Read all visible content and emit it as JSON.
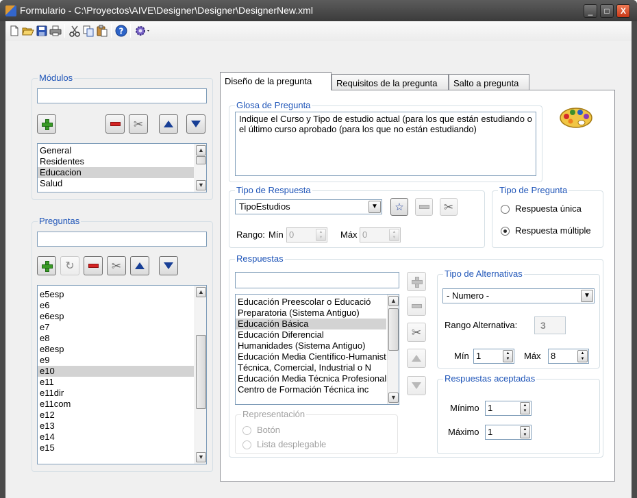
{
  "window": {
    "title": "Formulario - C:\\Proyectos\\AIVE\\Designer\\Designer\\DesignerNew.xml",
    "minimize_glyph": "_",
    "maximize_glyph": "□",
    "close_glyph": "X"
  },
  "toolbar": {
    "icons": [
      "new-icon",
      "open-icon",
      "save-icon",
      "print-icon",
      "cut-icon",
      "copy-icon",
      "paste-icon",
      "help-icon",
      "settings-icon"
    ]
  },
  "modulos": {
    "label": "Módulos",
    "search_value": "",
    "items": [
      "General",
      "Residentes",
      "Educacion",
      "Salud"
    ],
    "selected": "Educacion"
  },
  "preguntas": {
    "label": "Preguntas",
    "search_value": "",
    "items": [
      "e5esp",
      "e6",
      "e6esp",
      "e7",
      "e8",
      "e8esp",
      "e9",
      "e10",
      "e11",
      "e11dir",
      "e11com",
      "e12",
      "e13",
      "e14",
      "e15"
    ],
    "selected": "e10"
  },
  "tabs": [
    "Diseño de la pregunta",
    "Requisitos de la pregunta",
    "Salto a pregunta"
  ],
  "glosa": {
    "label": "Glosa de Pregunta",
    "text": "Indique el Curso y Tipo de estudio actual (para los que están estudiando o el último curso aprobado (para los que no están estudiando)"
  },
  "tipo_respuesta": {
    "label": "Tipo de Respuesta",
    "selected": "TipoEstudios",
    "rango_label": "Rango:",
    "min_label": "Mín",
    "min_value": "0",
    "max_label": "Máx",
    "max_value": "0"
  },
  "tipo_pregunta": {
    "label": "Tipo de Pregunta",
    "options": [
      "Respuesta única",
      "Respuesta múltiple"
    ],
    "checked": "Respuesta múltiple"
  },
  "respuestas": {
    "label": "Respuestas",
    "search_value": "",
    "items": [
      "Educación Preescolar o Educació",
      "Preparatoria (Sistema Antiguo)",
      "Educación Básica",
      "Educación Diferencial",
      "Humanidades (Sistema Antiguo)",
      "Educación Media Científico-Humanista",
      "Técnica, Comercial, Industrial o N",
      "Educación Media Técnica Profesional",
      "Centro de Formación Técnica inc"
    ],
    "selected": "Educación Básica"
  },
  "representacion": {
    "label": "Representación",
    "options": [
      "Botón",
      "Lista desplegable"
    ]
  },
  "tipo_alternativas": {
    "label": "Tipo de Alternativas",
    "selected": "- Numero -",
    "rango_label": "Rango Alternativa:",
    "rango_value": "3",
    "min_label": "Mín",
    "min_value": "1",
    "max_label": "Máx",
    "max_value": "8"
  },
  "respuestas_aceptadas": {
    "label": "Respuestas aceptadas",
    "min_label": "Mínimo",
    "min_value": "1",
    "max_label": "Máximo",
    "max_value": "1"
  },
  "colors": {
    "group_label": "#1f55b8",
    "selection": "#d3d3d3",
    "title_bar": "#4a4a4a",
    "close_button": "#c73717"
  }
}
